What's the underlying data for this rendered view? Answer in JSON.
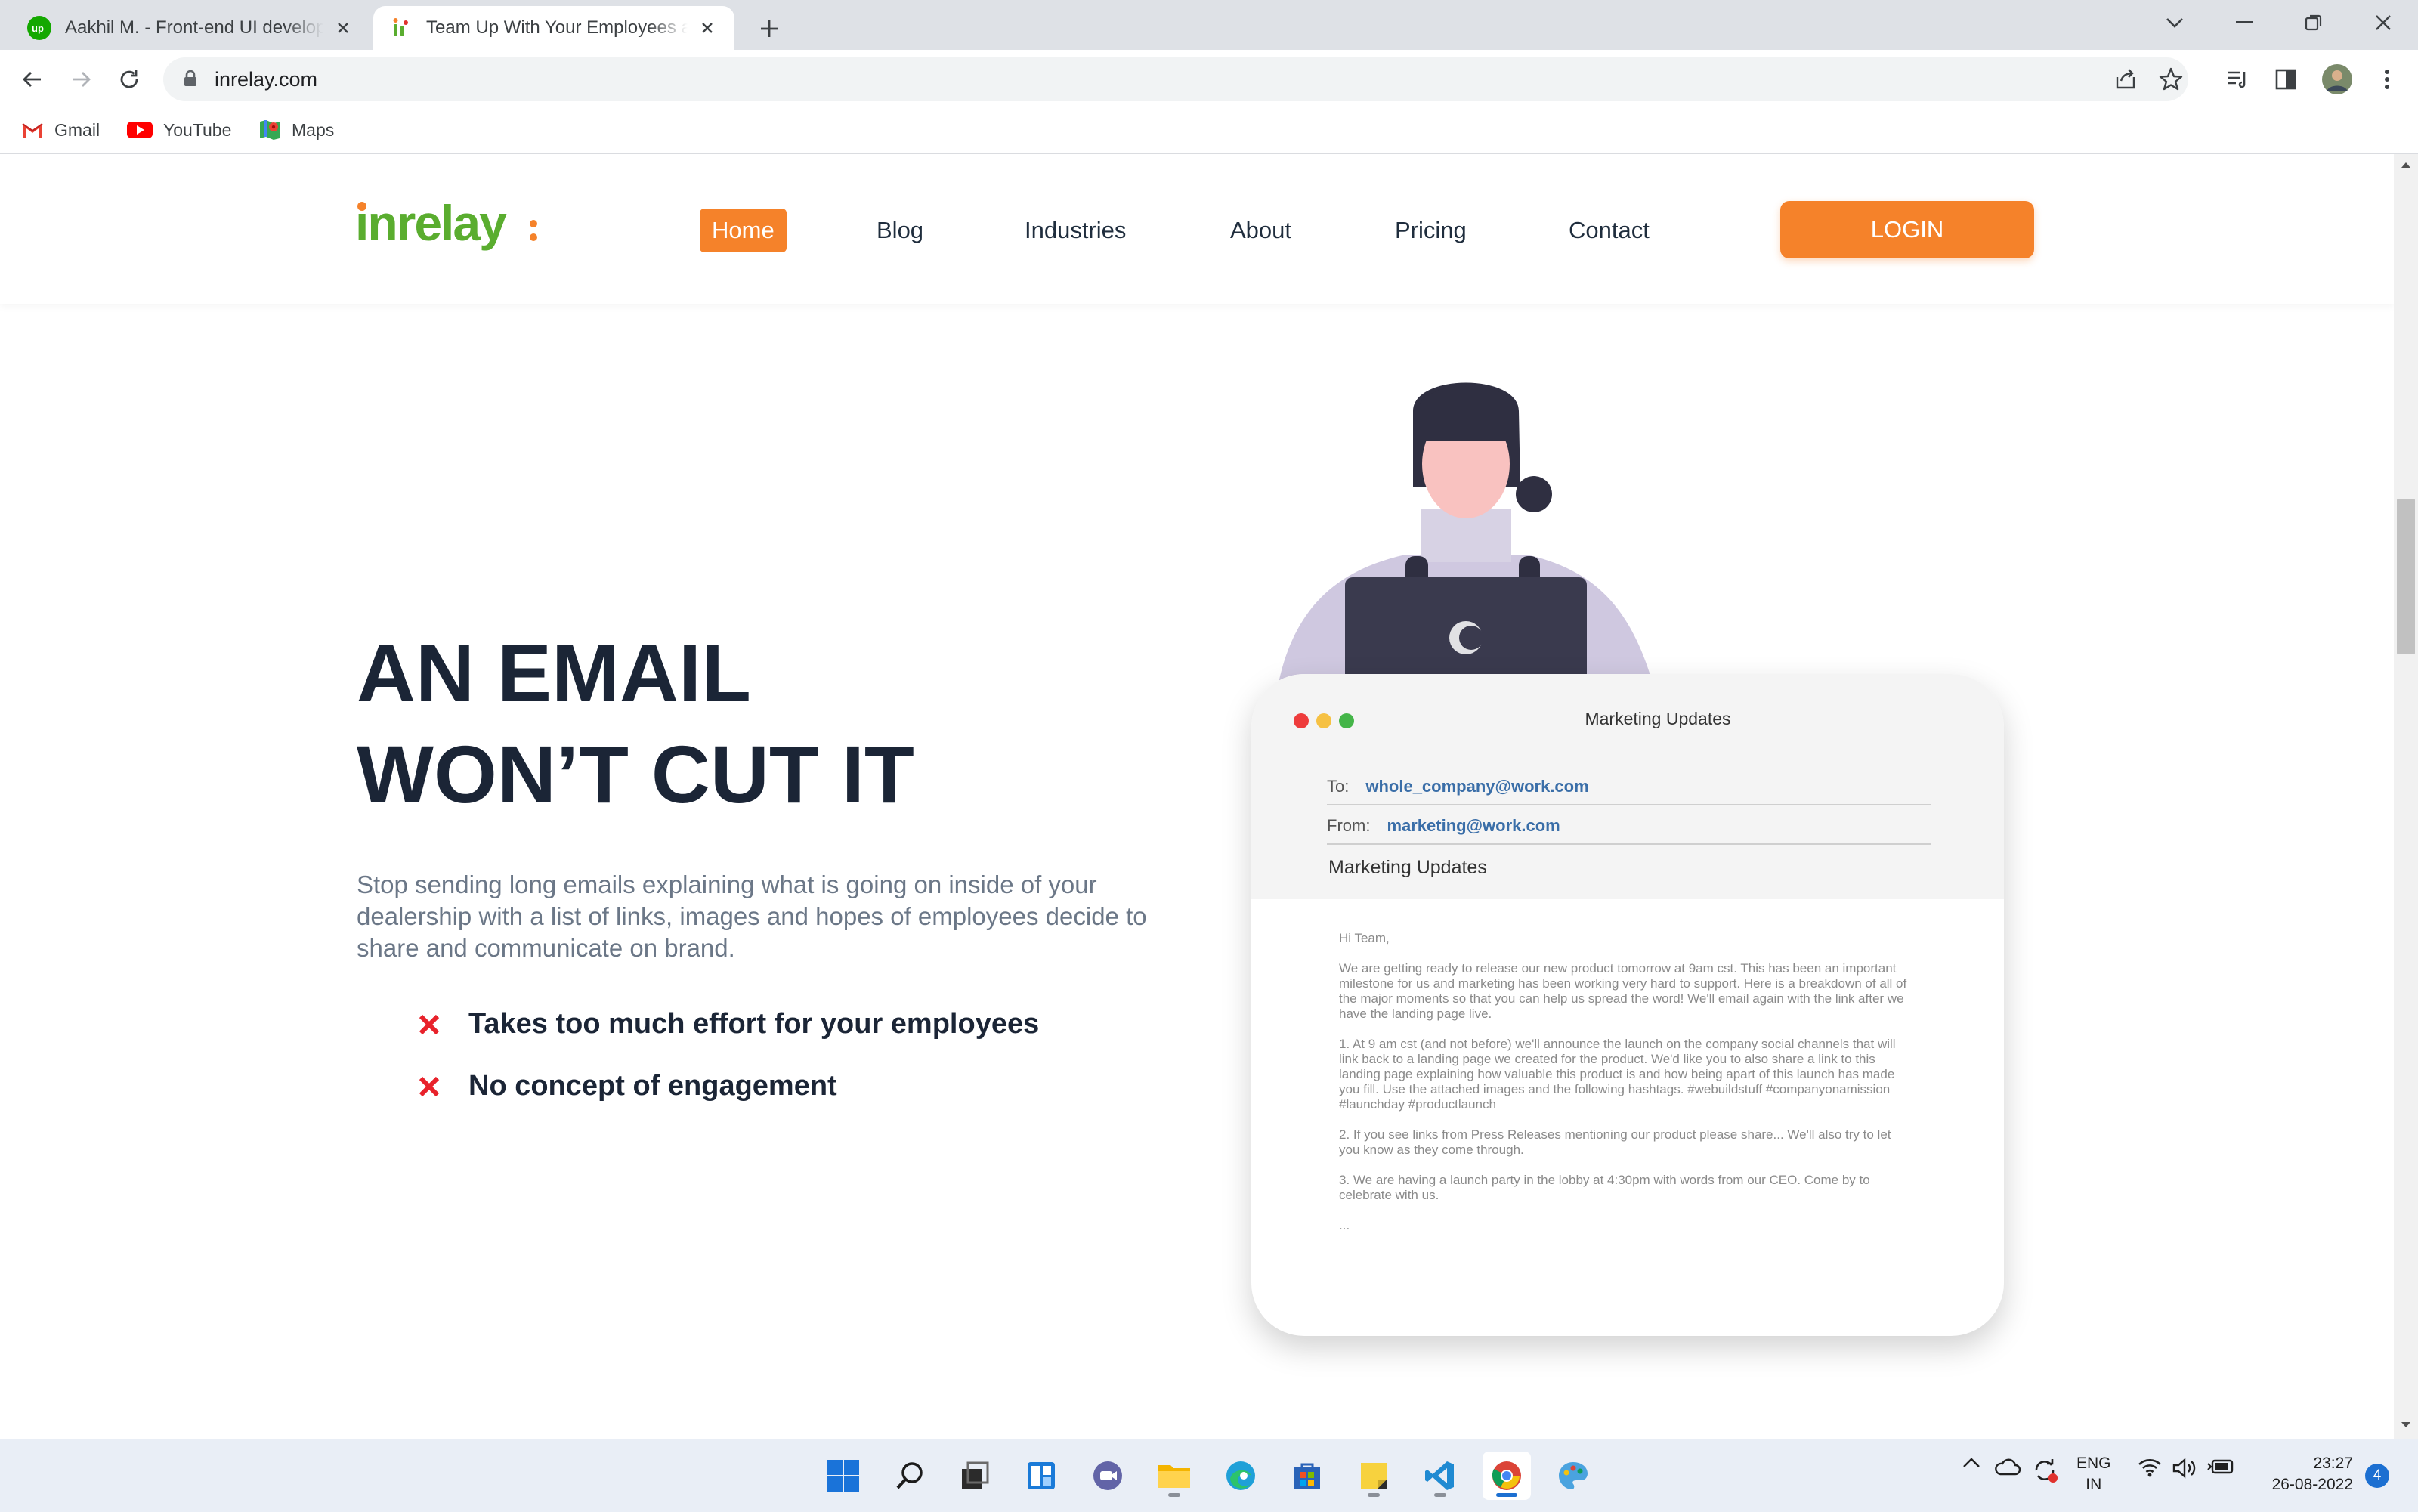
{
  "browser": {
    "tabs": [
      {
        "title": "Aakhil M. - Front-end UI developer"
      },
      {
        "title": "Team Up With Your Employees and"
      }
    ],
    "url": "inrelay.com",
    "bookmarks": [
      {
        "label": "Gmail",
        "icon": "gmail-icon"
      },
      {
        "label": "YouTube",
        "icon": "youtube-icon"
      },
      {
        "label": "Maps",
        "icon": "maps-icon"
      }
    ]
  },
  "site": {
    "logo": "inrelay",
    "nav": [
      {
        "label": "Home",
        "active": true
      },
      {
        "label": "Blog"
      },
      {
        "label": "Industries"
      },
      {
        "label": "About"
      },
      {
        "label": "Pricing"
      },
      {
        "label": "Contact"
      }
    ],
    "login": "LOGIN",
    "accent": "#f5822a",
    "brand_green": "#5aad2f"
  },
  "hero": {
    "title_line1": "AN EMAIL",
    "title_line2": "WON’T CUT IT",
    "description": "Stop sending long emails explaining what is going on inside of your dealership with a list of links, images and hopes of employees decide to share and communicate on brand.",
    "points": [
      "Takes too much effort for your employees",
      "No concept of engagement"
    ]
  },
  "email": {
    "window_title": "Marketing Updates",
    "to_label": "To:",
    "to_value": "whole_company@work.com",
    "from_label": "From:",
    "from_value": "marketing@work.com",
    "subject": "Marketing Updates",
    "greeting": "Hi Team,",
    "paragraphs": [
      "We are getting ready to release our new product tomorrow at 9am cst. This has been an important milestone for us and marketing has been working very hard to support. Here is a breakdown of all of the major moments so that you can help us spread the word! We'll email again with the link after we have the landing page live.",
      "1. At 9 am cst (and not before) we'll announce the launch on the company social channels that will link back to a landing page we created for the product. We'd like you to also share a link to this landing page explaining how valuable this product is and how being apart of this launch has made you fill. Use the attached images and the following hashtags. #webuildstuff #companyonamission #launchday #productlaunch",
      "2. If you see links from Press Releases mentioning our product please share... We'll also try to let you know as they come through.",
      "3. We are having a launch party in the lobby at 4:30pm with words from our CEO. Come by to celebrate with us.",
      "..."
    ]
  },
  "taskbar": {
    "lang_line1": "ENG",
    "lang_line2": "IN",
    "time": "23:27",
    "date": "26-08-2022",
    "notifications": "4"
  }
}
